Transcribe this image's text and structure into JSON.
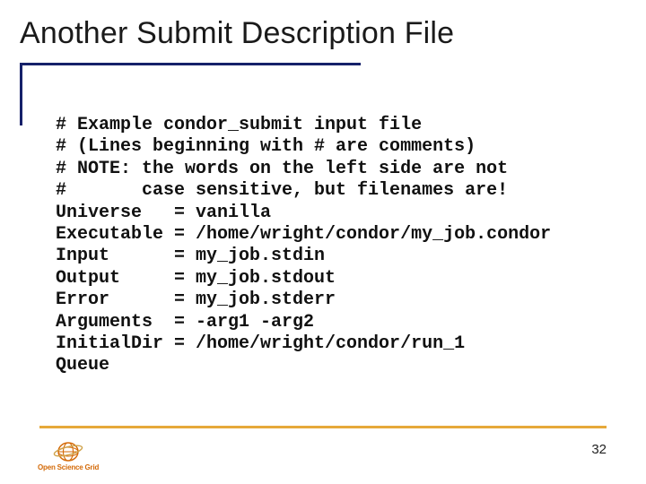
{
  "title": "Another Submit Description File",
  "code": "# Example condor_submit input file\n# (Lines beginning with # are comments)\n# NOTE: the words on the left side are not\n#       case sensitive, but filenames are!\nUniverse   = vanilla\nExecutable = /home/wright/condor/my_job.condor\nInput      = my_job.stdin\nOutput     = my_job.stdout\nError      = my_job.stderr\nArguments  = -arg1 -arg2\nInitialDir = /home/wright/condor/run_1\nQueue",
  "page_number": "32",
  "logo_text": "Open Science Grid"
}
